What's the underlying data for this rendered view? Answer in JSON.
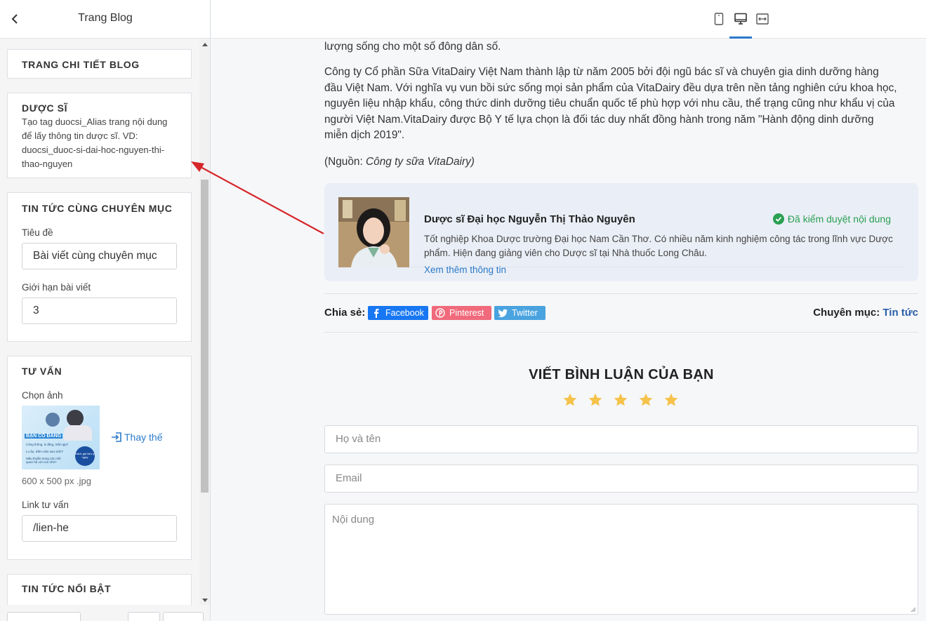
{
  "sidebar": {
    "title": "Trang Blog",
    "cards": {
      "detail": {
        "title": "TRANG CHI TIẾT BLOG"
      },
      "pharmacist": {
        "title": "DƯỢC SĨ",
        "desc": "Tạo tag duocsi_Alias trang nội dung để lấy thông tin dược sĩ. VD: duocsi_duoc-si-dai-hoc-nguyen-thi-thao-nguyen"
      },
      "related": {
        "title": "TIN TỨC CÙNG CHUYÊN MỤC",
        "title_label": "Tiêu đề",
        "title_value": "Bài viết cùng chuyên mục",
        "limit_label": "Giới hạn bài viết",
        "limit_value": "3"
      },
      "consult": {
        "title": "TƯ VẤN",
        "image_label": "Chọn ảnh",
        "image_size": "600 x 500 px .jpg",
        "replace_label": "Thay thế",
        "thumb_headline": "BẠN CÓ ĐANG",
        "thumb_items": [
          "Công thông, lo lắng, mất ngủ?",
          "Lo âu, trầm cảm sau sinh?",
          "Mâu thuẫn trong các mối quan hệ với con nhỏ?"
        ],
        "thumb_badge": "Đánh giá tâm lý ngay",
        "link_label": "Link tư vấn",
        "link_value": "/lien-he"
      },
      "featured": {
        "title": "TIN TỨC NỔI BẬT"
      }
    }
  },
  "topbar": {
    "devices": [
      "mobile-icon",
      "desktop-icon",
      "fullwidth-icon"
    ],
    "active_device": "desktop-icon"
  },
  "article": {
    "line0": "lượng sống cho một số đông dân số.",
    "para1_l1": "Công ty Cổ phần Sữa VitaDairy Việt Nam thành lập từ năm 2005 bởi đội ngũ bác sĩ và chuyên gia dinh dưỡng hàng",
    "para1_l2": "đầu Việt Nam. Với nghĩa vụ vun bồi sức sống mọi sản phẩm của VitaDairy đều dựa trên nền tảng nghiên cứu khoa học,",
    "para1_l3": "nguyên liệu nhập khẩu, công thức dinh dưỡng tiêu chuẩn quốc tế phù hợp với nhu cầu, thể trạng cũng như khẩu vị của",
    "para1_l4": "người Việt Nam.VitaDairy được Bộ Y tế lựa chọn là đối tác duy nhất đồng hành trong năm \"Hành động dinh dưỡng",
    "para1_l5": "miễn dịch 2019\".",
    "source_prefix": "(Nguồn: ",
    "source_name": "Công ty sữa VitaDairy)"
  },
  "author": {
    "name": "Dược sĩ Đại học Nguyễn Thị Thảo Nguyên",
    "verified": "Đã kiểm duyệt nội dung",
    "desc_l1": "Tốt nghiệp Khoa Dược trường Đại học Nam Cần Thơ. Có nhiều năm kinh nghiệm công tác trong lĩnh vực Dược",
    "desc_l2": "phẩm. Hiện đang giảng viên cho Dược sĩ tại Nhà thuốc Long Châu.",
    "more": "Xem thêm thông tin"
  },
  "share": {
    "label": "Chia sẻ:",
    "buttons": [
      {
        "label": "Facebook",
        "color": "#1877f2"
      },
      {
        "label": "Pinterest",
        "color": "#f06a7b"
      },
      {
        "label": "Twitter",
        "color": "#4aa3df"
      }
    ],
    "category_label": "Chuyên mục:",
    "category_value": "Tin tức"
  },
  "comment": {
    "title": "VIẾT BÌNH LUẬN CỦA BẠN",
    "rating_max": 5,
    "star_color": "#f5c24a",
    "name_placeholder": "Họ và tên",
    "email_placeholder": "Email",
    "content_placeholder": "Nội dung"
  },
  "colors": {
    "accent": "#2a7ac9",
    "verified": "#2aa052",
    "annotation_arrow": "#d7262a"
  }
}
